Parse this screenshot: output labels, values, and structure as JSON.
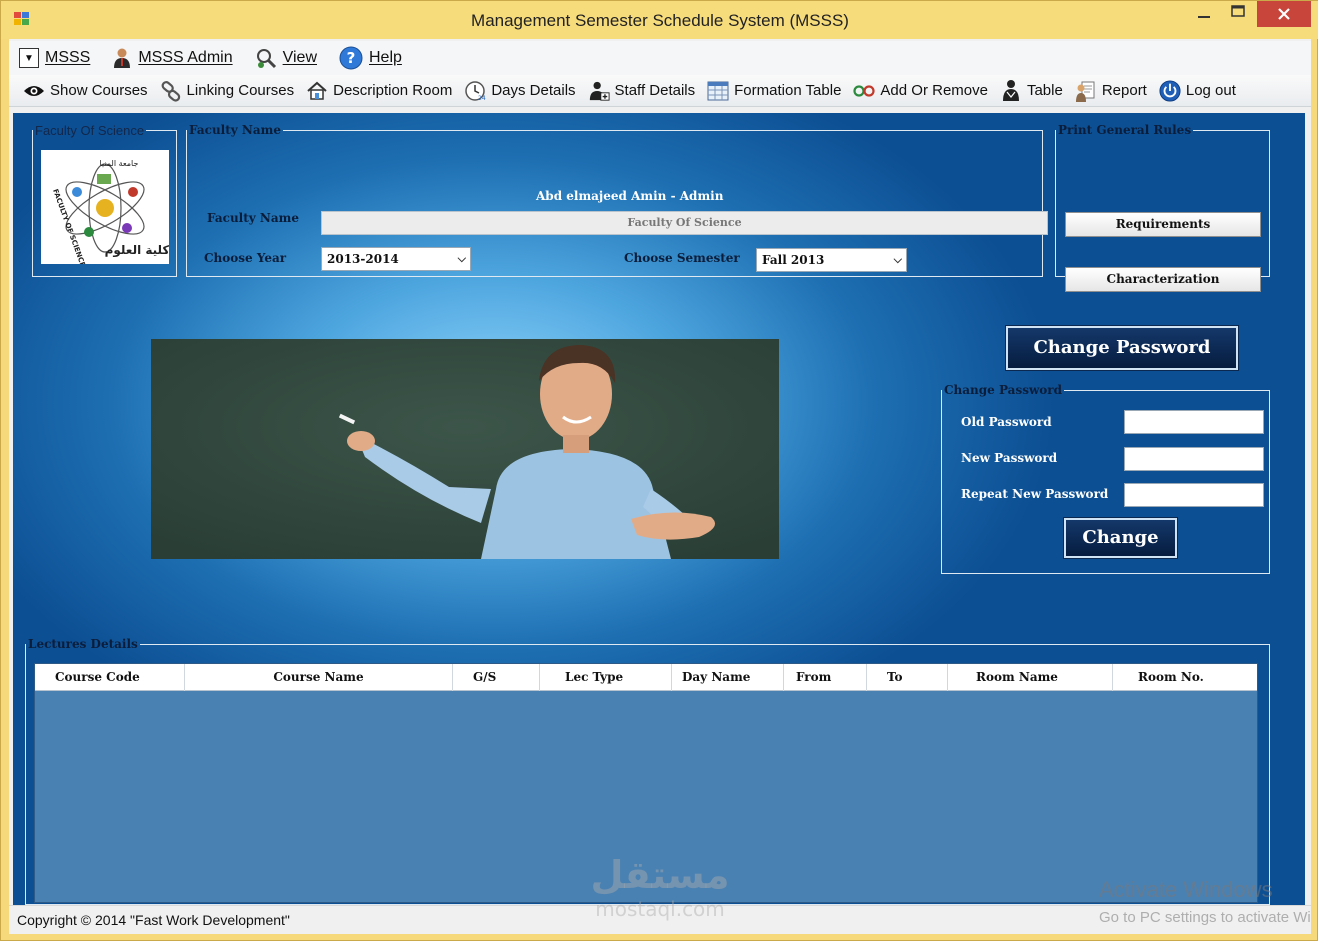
{
  "window": {
    "title": "Management Semester Schedule System (MSSS)"
  },
  "menu": {
    "items": [
      {
        "label": "MSSS",
        "icon": "dropdown-box-icon"
      },
      {
        "label": "MSSS Admin",
        "icon": "admin-user-icon"
      },
      {
        "label": "View",
        "icon": "view-search-icon"
      },
      {
        "label": "Help",
        "icon": "help-icon"
      }
    ]
  },
  "toolbar": {
    "items": [
      {
        "label": "Show Courses",
        "icon": "eye-icon"
      },
      {
        "label": "Linking Courses",
        "icon": "chain-link-icon"
      },
      {
        "label": "Description Room",
        "icon": "home-icon"
      },
      {
        "label": "Days Details",
        "icon": "clock-icon"
      },
      {
        "label": "Staff Details",
        "icon": "staff-icon"
      },
      {
        "label": "Formation Table",
        "icon": "table-grid-icon"
      },
      {
        "label": "Add Or Remove",
        "icon": "add-remove-icon"
      },
      {
        "label": "Table",
        "icon": "hierarchy-icon"
      },
      {
        "label": "Report",
        "icon": "report-icon"
      },
      {
        "label": "Log out",
        "icon": "logout-icon"
      }
    ]
  },
  "faculty_logo": {
    "legend": "Faculty Of Science",
    "logo_text_top": "جامعة المنيا",
    "logo_text_left": "FACULTY OF SCIENCE",
    "logo_text_right": "كلية العلوم"
  },
  "faculty_panel": {
    "legend": "Faculty Name",
    "user_line": "Abd elmajeed Amin - Admin",
    "faculty_label": "Faculty Name",
    "faculty_value": "Faculty Of Science",
    "year_label": "Choose Year",
    "year_value": "2013-2014",
    "semester_label": "Choose Semester",
    "semester_value": "Fall 2013"
  },
  "print_rules": {
    "legend": "Print General Rules",
    "requirements_label": "Requirements",
    "characterization_label": "Characterization"
  },
  "change_password": {
    "toggle_label": "Change Password",
    "legend": "Change Password",
    "old_label": "Old Password",
    "new_label": "New Password",
    "repeat_label": "Repeat New Password",
    "old_value": "",
    "new_value": "",
    "repeat_value": "",
    "submit_label": "Change"
  },
  "lectures": {
    "legend": "Lectures Details",
    "columns": [
      "Course Code",
      "Course Name",
      "G/S",
      "Lec Type",
      "Day Name",
      "From",
      "To",
      "Room Name",
      "Room No."
    ],
    "rows": []
  },
  "status": {
    "copyright": "Copyright © 2014 \"Fast Work Development\""
  },
  "overlay": {
    "activate_title": "Activate Windows",
    "activate_sub": "Go to PC settings to activate Windows.",
    "watermark_arabic": "مستقل",
    "watermark_latin": "mostaql.com"
  },
  "colors": {
    "title_bar": "#f7dc7c",
    "close_button": "#c7453b",
    "panel_gradient_center": "#8fd4fb",
    "panel_gradient_edge": "#0d4f93",
    "grid_body": "#4a81b3",
    "dark_button": "#0a2850"
  }
}
